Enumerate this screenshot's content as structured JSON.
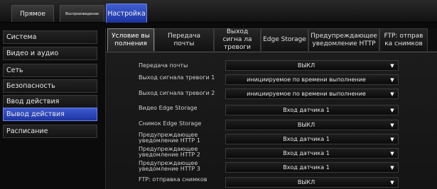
{
  "top_tabs": {
    "live": "Прямое",
    "playback": "Воспроизведение",
    "settings": "Настройка"
  },
  "sidebar": {
    "items": [
      {
        "label": "Система"
      },
      {
        "label": "Видео и аудио"
      },
      {
        "label": "Сеть"
      },
      {
        "label": "Безопасность"
      },
      {
        "label": "Ввод действия"
      },
      {
        "label": "Вывод действия"
      },
      {
        "label": "Расписание"
      }
    ],
    "active_index": 5
  },
  "subtabs": [
    {
      "label": "Условие вы полнения"
    },
    {
      "label": "Передача почты"
    },
    {
      "label": "Выход сигна ла тревоги"
    },
    {
      "label": "Edge Storage"
    },
    {
      "label": "Предупреждающее уведомление HTTP"
    },
    {
      "label": "FTP: отправ ка снимков"
    }
  ],
  "form": {
    "rows": [
      {
        "label": "Передача почты",
        "value": "ВЫКЛ"
      },
      {
        "label": "Выход сигнала тревоги 1",
        "value": "инициируемое по времени выполнение"
      },
      {
        "label": "Выход сигнала тревоги 2",
        "value": "инициируемое по времени выполнение"
      },
      {
        "label": "Видео Edge Storage",
        "value": "Вход датчика 1"
      },
      {
        "label": "Снимок Edge Storage",
        "value": "ВЫКЛ"
      },
      {
        "label": "Предупреждающее уведомление HTTP 1",
        "value": "Вход датчика 1"
      },
      {
        "label": "Предупреждающее уведомление HTTP 2",
        "value": "Вход датчика 1"
      },
      {
        "label": "Предупреждающее уведомление HTTP 3",
        "value": "Вход датчика 1"
      },
      {
        "label": "FTP: отправка снимков",
        "value": "ВЫКЛ"
      }
    ]
  },
  "colors": {
    "accent": "#2a45b8",
    "background": "#0b0b0b"
  },
  "icons": {
    "dropdown": "triangle-down-icon"
  }
}
